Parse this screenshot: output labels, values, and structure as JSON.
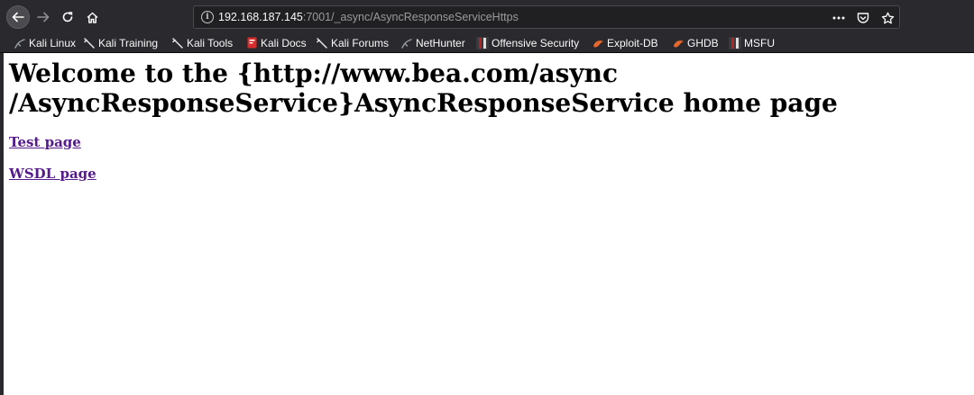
{
  "browser": {
    "url_host": "192.168.187.145",
    "url_rest": ":7001/_async/AsyncResponseServiceHttps"
  },
  "bookmarks": [
    {
      "label": "Kali Linux",
      "icon": "kali-dragon-icon"
    },
    {
      "label": "Kali Training",
      "icon": "kali-dragon-icon"
    },
    {
      "label": "Kali Tools",
      "icon": "kali-dragon-icon"
    },
    {
      "label": "Kali Docs",
      "icon": "red-book-icon"
    },
    {
      "label": "Kali Forums",
      "icon": "kali-dragon-icon"
    },
    {
      "label": "NetHunter",
      "icon": "nethunter-icon"
    },
    {
      "label": "Offensive Security",
      "icon": "offsec-icon"
    },
    {
      "label": "Exploit-DB",
      "icon": "exploit-db-icon"
    },
    {
      "label": "GHDB",
      "icon": "exploit-db-icon"
    },
    {
      "label": "MSFU",
      "icon": "offsec-icon"
    }
  ],
  "page": {
    "heading_line1": "Welcome to the {http://www.bea.com/async",
    "heading_line2": "/AsyncResponseService}AsyncResponseService home page",
    "links": {
      "test": "Test page",
      "wsdl": "WSDL page"
    }
  },
  "colors": {
    "chrome_bg": "#2a2a2e",
    "link_visited": "#551a8b",
    "exploit_db_orange": "#e8682c",
    "offsec_red": "#b3231f"
  }
}
